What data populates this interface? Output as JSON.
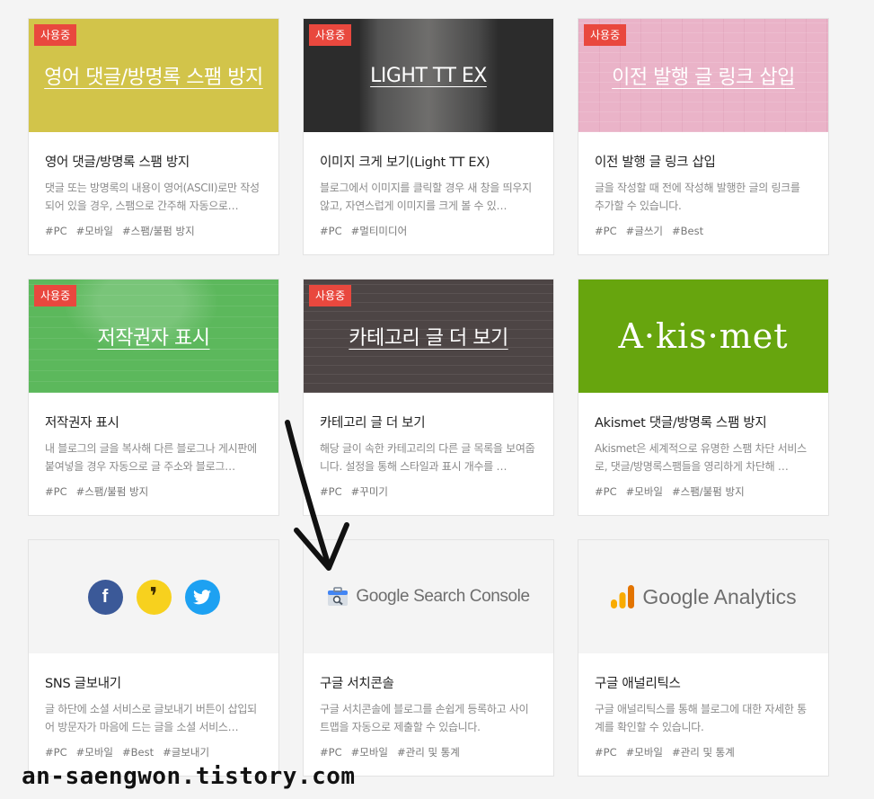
{
  "plugins": [
    {
      "thumb_title": "영어 댓글/방명록 스팸 방지",
      "badge": "사용중",
      "name": "영어 댓글/방명록 스팸 방지",
      "desc": "댓글 또는 방명록의 내용이 영어(ASCII)로만 작성되어 있을 경우, 스팸으로 간주해 자동으로…",
      "tags": [
        "#PC",
        "#모바일",
        "#스팸/불펌 방지"
      ],
      "thumb_color": "#d2c44a"
    },
    {
      "thumb_title": "LIGHT TT EX",
      "badge": "사용중",
      "name": "이미지 크게 보기(Light TT EX)",
      "desc": "블로그에서 이미지를 클릭할 경우 새 창을 띄우지 않고, 자연스럽게 이미지를 크게 볼 수 있…",
      "tags": [
        "#PC",
        "#멀티미디어"
      ],
      "thumb_color": "#2c2c2c"
    },
    {
      "thumb_title": "이전 발행 글 링크 삽입",
      "badge": "사용중",
      "name": "이전 발행 글 링크 삽입",
      "desc": "글을 작성할 때 전에 작성해 발행한 글의 링크를 추가할 수 있습니다.",
      "tags": [
        "#PC",
        "#글쓰기",
        "#Best"
      ],
      "thumb_color": "#eab3c8"
    },
    {
      "thumb_title": "저작권자 표시",
      "badge": "사용중",
      "name": "저작권자 표시",
      "desc": "내 블로그의 글을 복사해 다른 블로그나 게시판에 붙여넣을 경우 자동으로 글 주소와 블로그…",
      "tags": [
        "#PC",
        "#스팸/불펌 방지"
      ],
      "thumb_color": "#5cb85c"
    },
    {
      "thumb_title": "카테고리 글 더 보기",
      "badge": "사용중",
      "name": "카테고리 글 더 보기",
      "desc": "해당 글이 속한 카테고리의 다른 글 목록을 보여줍니다. 설정을 통해 스타일과 표시 개수를 …",
      "tags": [
        "#PC",
        "#꾸미기"
      ],
      "thumb_color": "#4d4545"
    },
    {
      "thumb_title": "A·kis·met",
      "name": "Akismet 댓글/방명록 스팸 방지",
      "desc": "Akismet은 세계적으로 유명한 스팸 차단 서비스로, 댓글/방명록스팸들을 영리하게 차단해 …",
      "tags": [
        "#PC",
        "#모바일",
        "#스팸/불펌 방지"
      ],
      "thumb_color": "#67a50e"
    },
    {
      "name": "SNS 글보내기",
      "desc": "글 하단에 소셜 서비스로 글보내기 버튼이 삽입되어 방문자가 마음에 드는 글을 소셜 서비스…",
      "tags": [
        "#PC",
        "#모바일",
        "#Best",
        "#글보내기"
      ],
      "thumb_color": "#f4f4f4",
      "sns": [
        {
          "icon": "facebook-icon",
          "glyph": "f",
          "color": "#3b5998"
        },
        {
          "icon": "kakao-icon",
          "glyph": "❜",
          "color": "#f7d11e"
        },
        {
          "icon": "twitter-icon",
          "glyph": "🐦",
          "color": "#1da1f2"
        }
      ]
    },
    {
      "thumb_title": "Google Search Console",
      "name": "구글 서치콘솔",
      "desc": "구글 서치콘솔에 블로그를 손쉽게 등록하고 사이트맵을 자동으로 제출할 수 있습니다.",
      "tags": [
        "#PC",
        "#모바일",
        "#관리 및 통계"
      ],
      "thumb_color": "#f4f4f4"
    },
    {
      "thumb_title": "Google Analytics",
      "name": "구글 애널리틱스",
      "desc": "구글 애널리틱스를 통해 블로그에 대한 자세한 통계를 확인할 수 있습니다.",
      "tags": [
        "#PC",
        "#모바일",
        "#관리 및 통계"
      ],
      "thumb_color": "#f4f4f4"
    }
  ],
  "watermark": "an-saengwon.tistory.com",
  "colors": {
    "badge": "#e9483e",
    "background": "#f4f4f4"
  }
}
